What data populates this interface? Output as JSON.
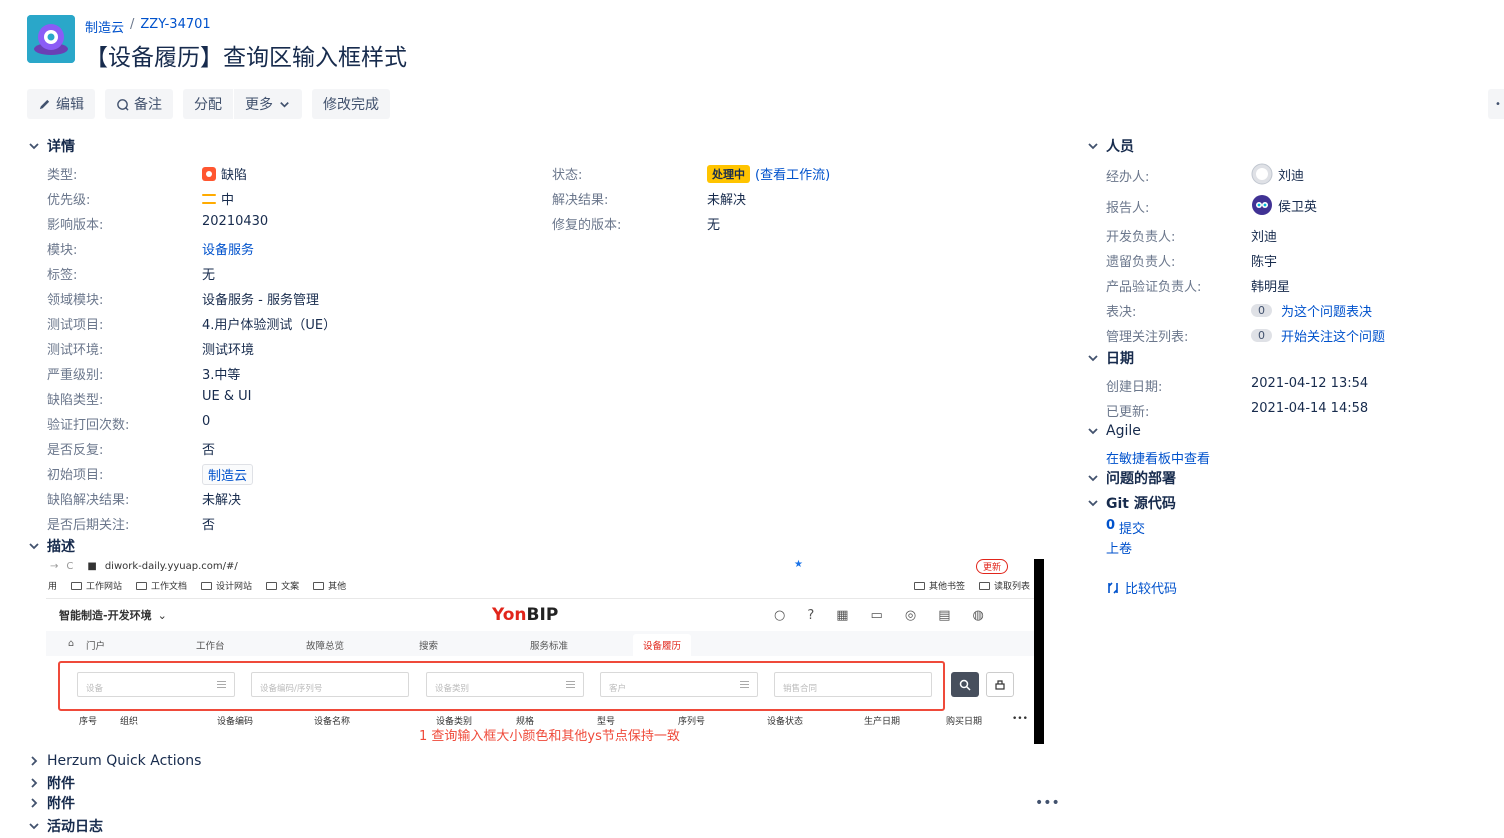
{
  "header": {
    "project_name": "制造云",
    "issue_key": "ZZY-34701",
    "title": "【设备履历】查询区输入框样式"
  },
  "toolbar": {
    "edit": "编辑",
    "comment": "备注",
    "assign": "分配",
    "more": "更多",
    "done": "修改完成"
  },
  "details": {
    "heading": "详情",
    "fields": [
      {
        "label": "类型:",
        "value": "缺陷"
      },
      {
        "label": "优先级:",
        "value": "中"
      },
      {
        "label": "影响版本:",
        "value": "20210430"
      },
      {
        "label": "模块:",
        "value": "设备服务"
      },
      {
        "label": "标签:",
        "value": "无"
      },
      {
        "label": "领域模块:",
        "value": "设备服务 - 服务管理"
      },
      {
        "label": "测试项目:",
        "value": "4.用户体验测试（UE）"
      },
      {
        "label": "测试环境:",
        "value": "测试环境"
      },
      {
        "label": "严重级别:",
        "value": "3.中等"
      },
      {
        "label": "缺陷类型:",
        "value": "UE & UI"
      },
      {
        "label": "验证打回次数:",
        "value": "0"
      },
      {
        "label": "是否反复:",
        "value": "否"
      },
      {
        "label": "初始项目:",
        "value": "制造云"
      },
      {
        "label": "缺陷解决结果:",
        "value": "未解决"
      },
      {
        "label": "是否后期关注:",
        "value": "否"
      }
    ],
    "right_fields": [
      {
        "label": "状态:",
        "value": "处理中",
        "link": "(查看工作流)"
      },
      {
        "label": "解决结果:",
        "value": "未解决"
      },
      {
        "label": "修复的版本:",
        "value": "无"
      }
    ]
  },
  "description": {
    "heading": "描述",
    "screenshot": {
      "url": "diwork-daily.yyuap.com/#/",
      "update_btn": "更新",
      "bookmarks": [
        "用",
        "工作网站",
        "工作文档",
        "设计网站",
        "文案",
        "其他"
      ],
      "bookmarks_right": [
        "其他书签",
        "读取列表"
      ],
      "app_name": "智能制造-开发环境",
      "brand_red": "Yon",
      "brand_dark": "BIP",
      "tabs": [
        "门户",
        "工作台",
        "故障总览",
        "搜索",
        "服务标准",
        "设备履历"
      ],
      "inputs": [
        "设备",
        "设备编码/序列号",
        "设备类别",
        "客户",
        "销售合同"
      ],
      "columns": [
        "序号",
        "组织",
        "设备编码",
        "设备名称",
        "设备类别",
        "规格",
        "型号",
        "序列号",
        "设备状态",
        "生产日期",
        "购买日期"
      ],
      "annotation": "1 查询输入框大小颜色和其他ys节点保持一致"
    }
  },
  "collapsed_sections": [
    "Herzum Quick Actions",
    "附件",
    "附件",
    "活动日志"
  ],
  "people": {
    "heading": "人员",
    "assignee_label": "经办人:",
    "assignee": "刘迪",
    "reporter_label": "报告人:",
    "reporter": "侯卫英",
    "dev_label": "开发负责人:",
    "dev": "刘迪",
    "legacy_label": "遗留负责人:",
    "legacy": "陈宇",
    "verify_label": "产品验证负责人:",
    "verify": "韩明星",
    "vote_label": "表决:",
    "vote_count": "0",
    "vote_link": "为这个问题表决",
    "watch_label": "管理关注列表:",
    "watch_count": "0",
    "watch_link": "开始关注这个问题"
  },
  "dates": {
    "heading": "日期",
    "created_label": "创建日期:",
    "created": "2021-04-12 13:54",
    "updated_label": "已更新:",
    "updated": "2021-04-14 14:58"
  },
  "agile": {
    "heading": "Agile",
    "link": "在敏捷看板中查看"
  },
  "deploy": {
    "heading": "问题的部署"
  },
  "git": {
    "heading": "Git 源代码",
    "commits_count": "0",
    "commits_label": "提交",
    "pull_label": "上卷",
    "compare": "比较代码"
  },
  "colors": {
    "accent": "#0052cc",
    "status": "#ffc400",
    "bug": "#ff5630",
    "annotation": "#ef4a3a"
  }
}
